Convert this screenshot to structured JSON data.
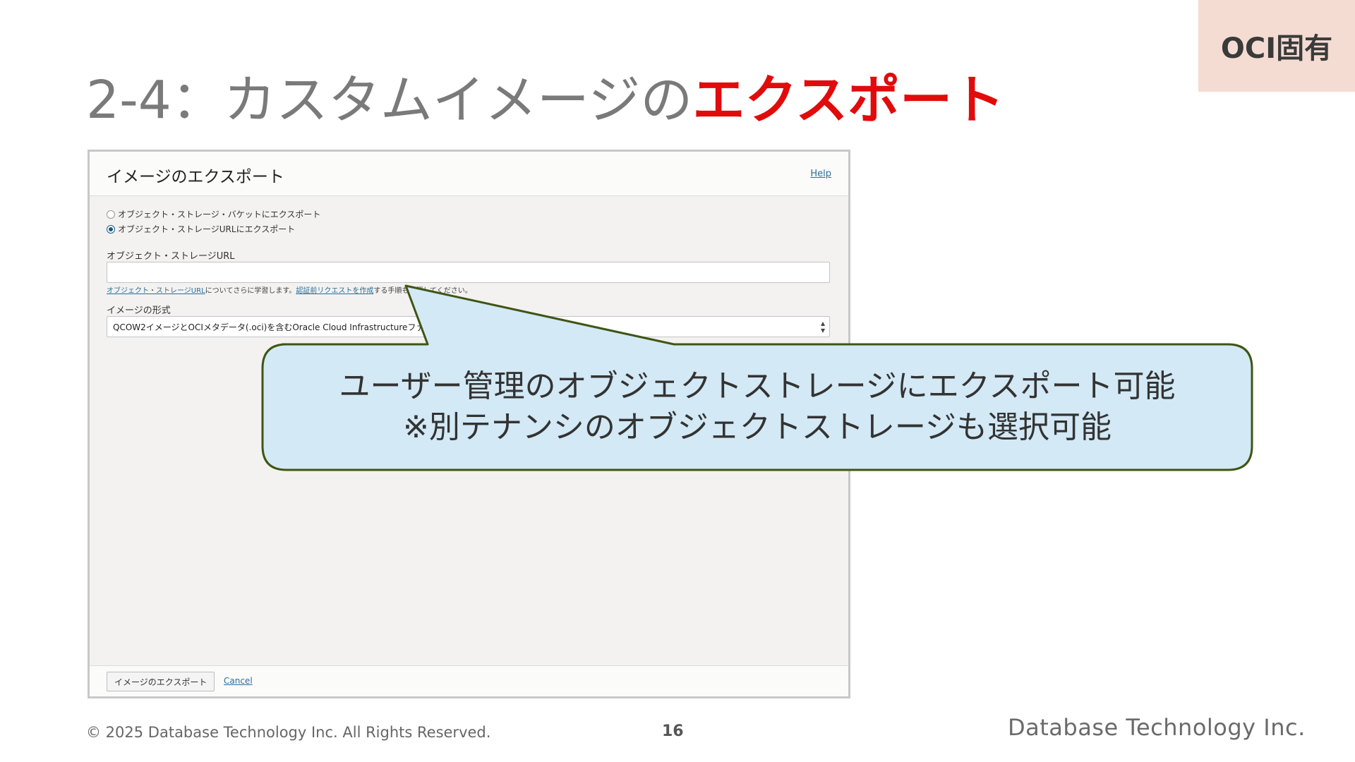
{
  "tag": {
    "label": "OCI固有"
  },
  "title": {
    "prefix": "2-4：カスタムイメージの",
    "accent": "エクスポート"
  },
  "dialog": {
    "title": "イメージのエクスポート",
    "help": "Help",
    "options": [
      {
        "label": "オブジェクト・ストレージ・バケットにエクスポート",
        "selected": false
      },
      {
        "label": "オブジェクト・ストレージURLにエクスポート",
        "selected": true
      }
    ],
    "url_label": "オブジェクト・ストレージURL",
    "url_value": "",
    "helper": {
      "link1": "オブジェクト・ストレージURL",
      "text1": "についてさらに学習します。",
      "link2": "認証前リクエストを作成",
      "text2": "する手順も参照してください。"
    },
    "format_label": "イメージの形式",
    "format_value": "QCOW2イメージとOCIメタデータ(.oci)を含むOracle Cloud Infrastructureファイル",
    "export_button": "イメージのエクスポート",
    "cancel": "Cancel"
  },
  "callout": {
    "line1": "ユーザー管理のオブジェクトストレージにエクスポート可能",
    "line2": "※別テナンシのオブジェクトストレージも選択可能",
    "fill": "#d3e9f5",
    "stroke": "#3f5514"
  },
  "footer": {
    "copyright": "© 2025 Database Technology Inc. All Rights Reserved.",
    "page": "16",
    "brand": "Database Technology Inc."
  }
}
